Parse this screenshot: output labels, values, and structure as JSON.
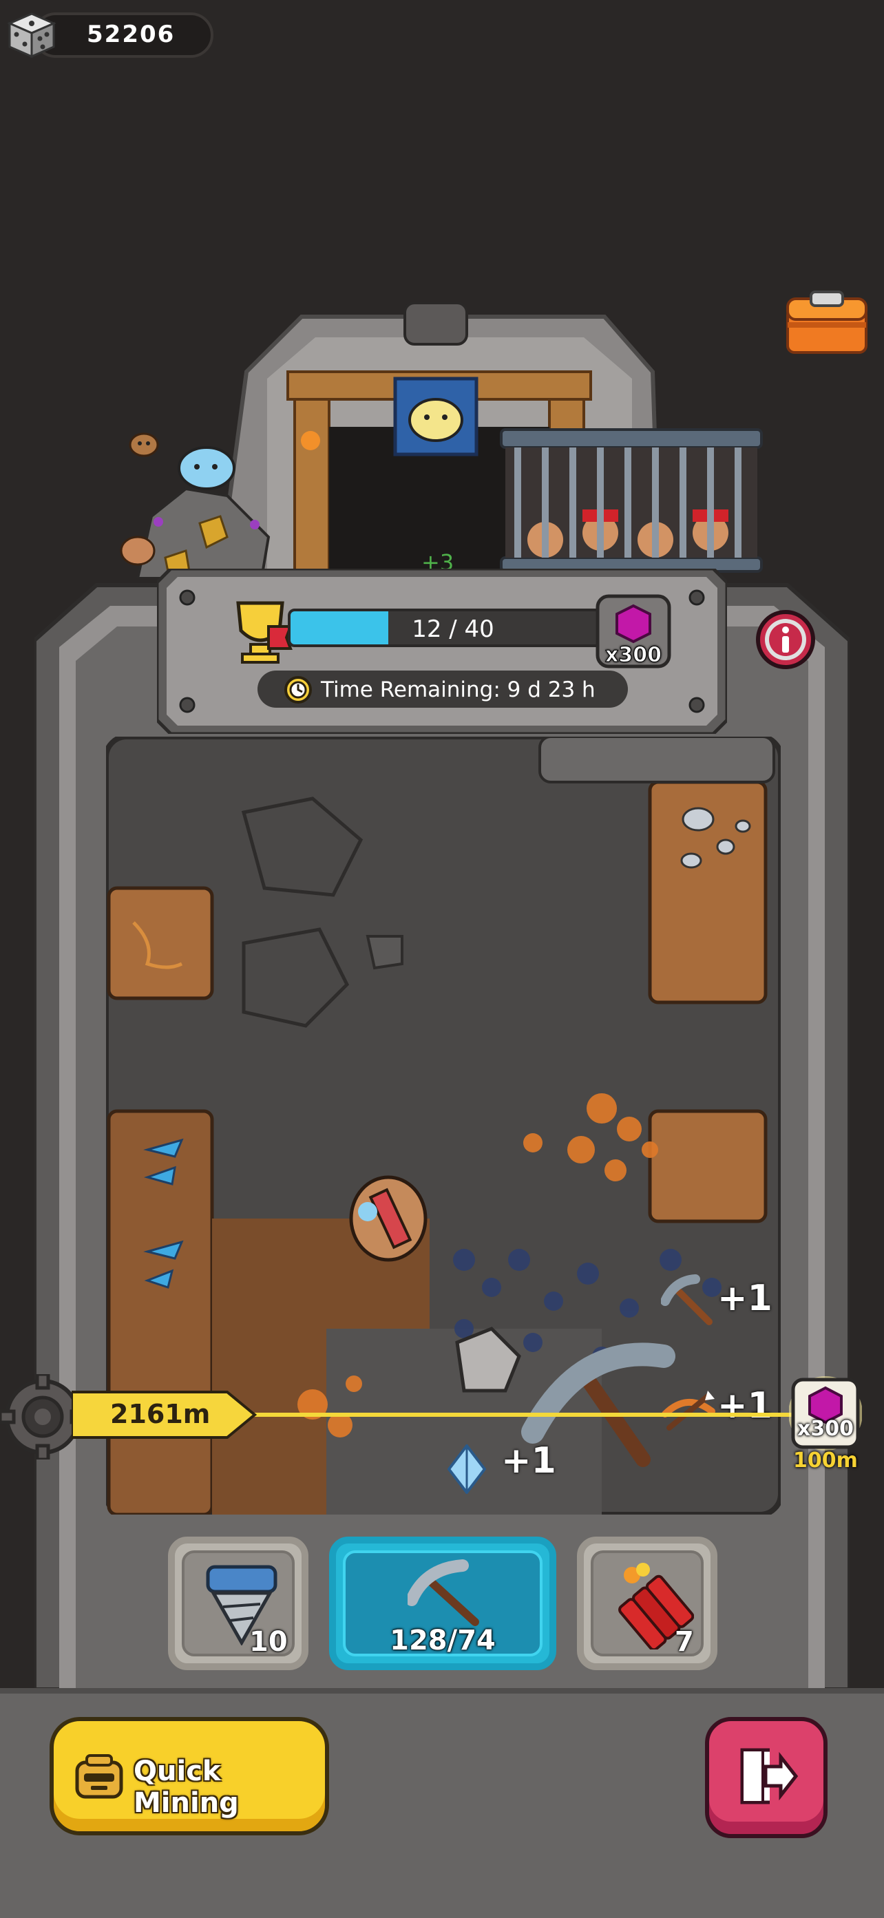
{
  "currency": {
    "amount": "52206",
    "icon": "dice-icon"
  },
  "event": {
    "progress_text": "12 / 40",
    "progress_current": 12,
    "progress_max": 40,
    "reward_count": "x300",
    "time_remaining": "Time Remaining: 9 d 23 h",
    "floating_gain": "+3"
  },
  "mine": {
    "depth": "2161m",
    "target_reward_count": "x300",
    "target_depth": "100m",
    "gains": {
      "pickaxe": "+1",
      "crossbow": "+1",
      "crystal": "+1"
    }
  },
  "tools": {
    "drill_count": "10",
    "pickaxe_count": "128/74",
    "dynamite_count": "7"
  },
  "buttons": {
    "quick_mining": "Quick Mining"
  },
  "colors": {
    "accent": "#3bc3ea",
    "depth_rope": "#f4d83a",
    "gem": "#b5139e",
    "quick": "#f8d02a",
    "exit": "#dc416b"
  }
}
